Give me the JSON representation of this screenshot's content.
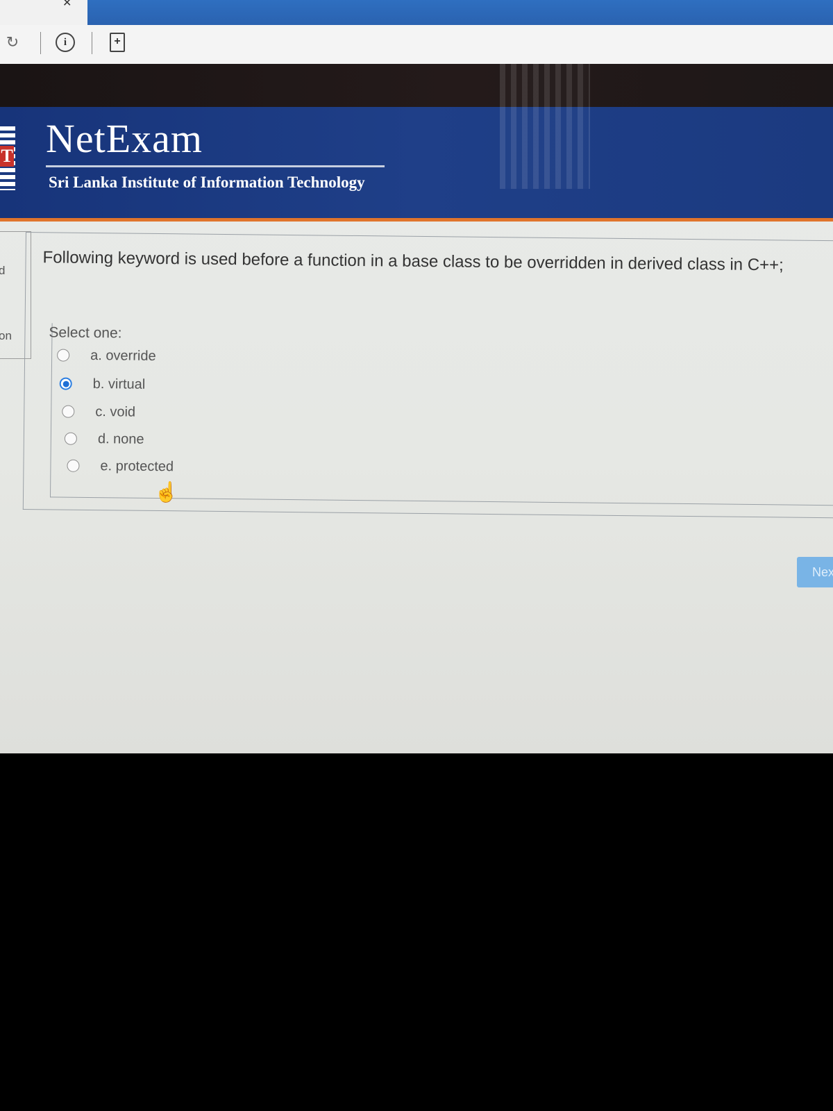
{
  "browser": {
    "reload_icon": "reload-icon",
    "info_icon_glyph": "i",
    "page_icon_glyph": "+"
  },
  "header": {
    "brand": "NetExam",
    "subtitle": "Sri Lanka Institute of Information Technology",
    "logo_letter": "T",
    "accent_color": "#e0742c",
    "bg_color": "#1b3a80"
  },
  "sidebar": {
    "fragments": [
      "d",
      "on"
    ]
  },
  "question": {
    "text": "Following keyword is used before a function in a base class to be overridden in derived class in C++;",
    "prompt": "Select one:",
    "options": [
      {
        "label": "a. override",
        "selected": false
      },
      {
        "label": "b. virtual",
        "selected": true
      },
      {
        "label": "c. void",
        "selected": false
      },
      {
        "label": "d. none",
        "selected": false
      },
      {
        "label": "e. protected",
        "selected": false
      }
    ]
  },
  "navigation": {
    "next_label": "Nex"
  }
}
